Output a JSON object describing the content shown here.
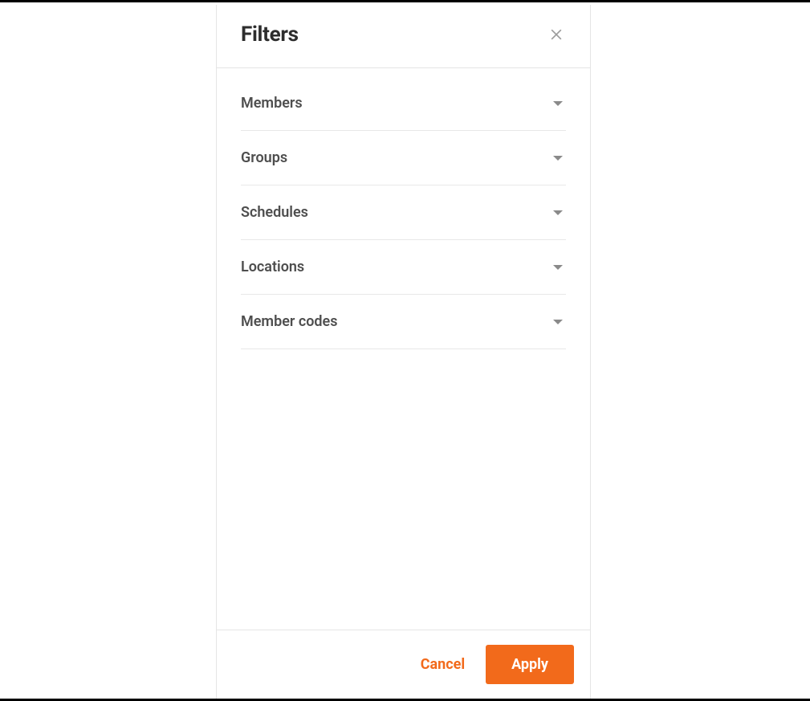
{
  "panel": {
    "title": "Filters",
    "sections": [
      {
        "label": "Members"
      },
      {
        "label": "Groups"
      },
      {
        "label": "Schedules"
      },
      {
        "label": "Locations"
      },
      {
        "label": "Member codes"
      }
    ],
    "buttons": {
      "cancel": "Cancel",
      "apply": "Apply"
    }
  }
}
